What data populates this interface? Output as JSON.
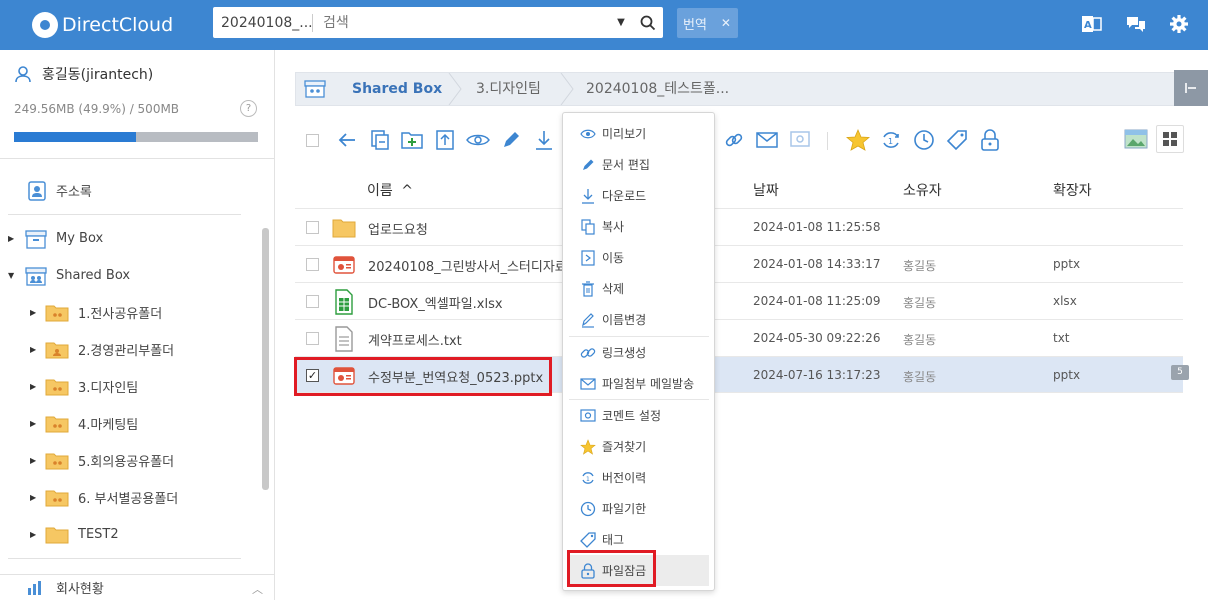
{
  "app": {
    "name": "DirectCloud"
  },
  "search": {
    "folder": "20240108_...",
    "placeholder": "검색",
    "tag": "번역"
  },
  "user": {
    "name": "홍길동(jirantech)",
    "storage": "249.56MB (49.9%) / 500MB",
    "storage_pct": 49.9,
    "help": "?"
  },
  "sidebar": {
    "address_book": "주소록",
    "my_box": "My Box",
    "shared_box": "Shared Box",
    "folders": [
      "1.전사공유폴더",
      "2.경영관리부폴더",
      "3.디자인팀",
      "4.마케팅팀",
      "5.회의용공유폴더",
      "6. 부서별공용폴더",
      "TEST2"
    ],
    "company": "회사현황"
  },
  "breadcrumb": {
    "root": "Shared Box",
    "items": [
      "3.디자인팀",
      "20240108_테스트폴..."
    ]
  },
  "columns": {
    "name": "이름",
    "sort": "^",
    "date": "날짜",
    "owner": "소유자",
    "ext": "확장자"
  },
  "files": [
    {
      "name": "업로드요청",
      "date": "2024-01-08 11:25:58",
      "owner": "",
      "ext": "",
      "type": "folder"
    },
    {
      "name": "20240108_그린방사서_스터디자료",
      "date": "2024-01-08 14:33:17",
      "owner": "홍길동",
      "ext": "pptx",
      "type": "pptx"
    },
    {
      "name": "DC-BOX_엑셀파일.xlsx",
      "date": "2024-01-08 11:25:09",
      "owner": "홍길동",
      "ext": "xlsx",
      "type": "xlsx"
    },
    {
      "name": "계약프로세스.txt",
      "date": "2024-05-30 09:22:26",
      "owner": "홍길동",
      "ext": "txt",
      "type": "txt"
    },
    {
      "name": "수정부분_번역요청_0523.pptx",
      "date": "2024-07-16 13:17:23",
      "owner": "홍길동",
      "ext": "pptx",
      "type": "pptx",
      "selected": true,
      "comments": "5"
    }
  ],
  "context_menu": {
    "items": [
      "미리보기",
      "문서 편집",
      "다운로드",
      "복사",
      "이동",
      "삭제",
      "이름변경",
      "링크생성",
      "파일첨부 메일발송",
      "코멘트 설정",
      "즐겨찾기",
      "버전이력",
      "파일기한",
      "태그",
      "파일잠금"
    ],
    "active": "파일잠금"
  },
  "colors": {
    "brand": "#3d86d1",
    "highlight": "#e01b24",
    "selected_row": "#dce6f4"
  }
}
